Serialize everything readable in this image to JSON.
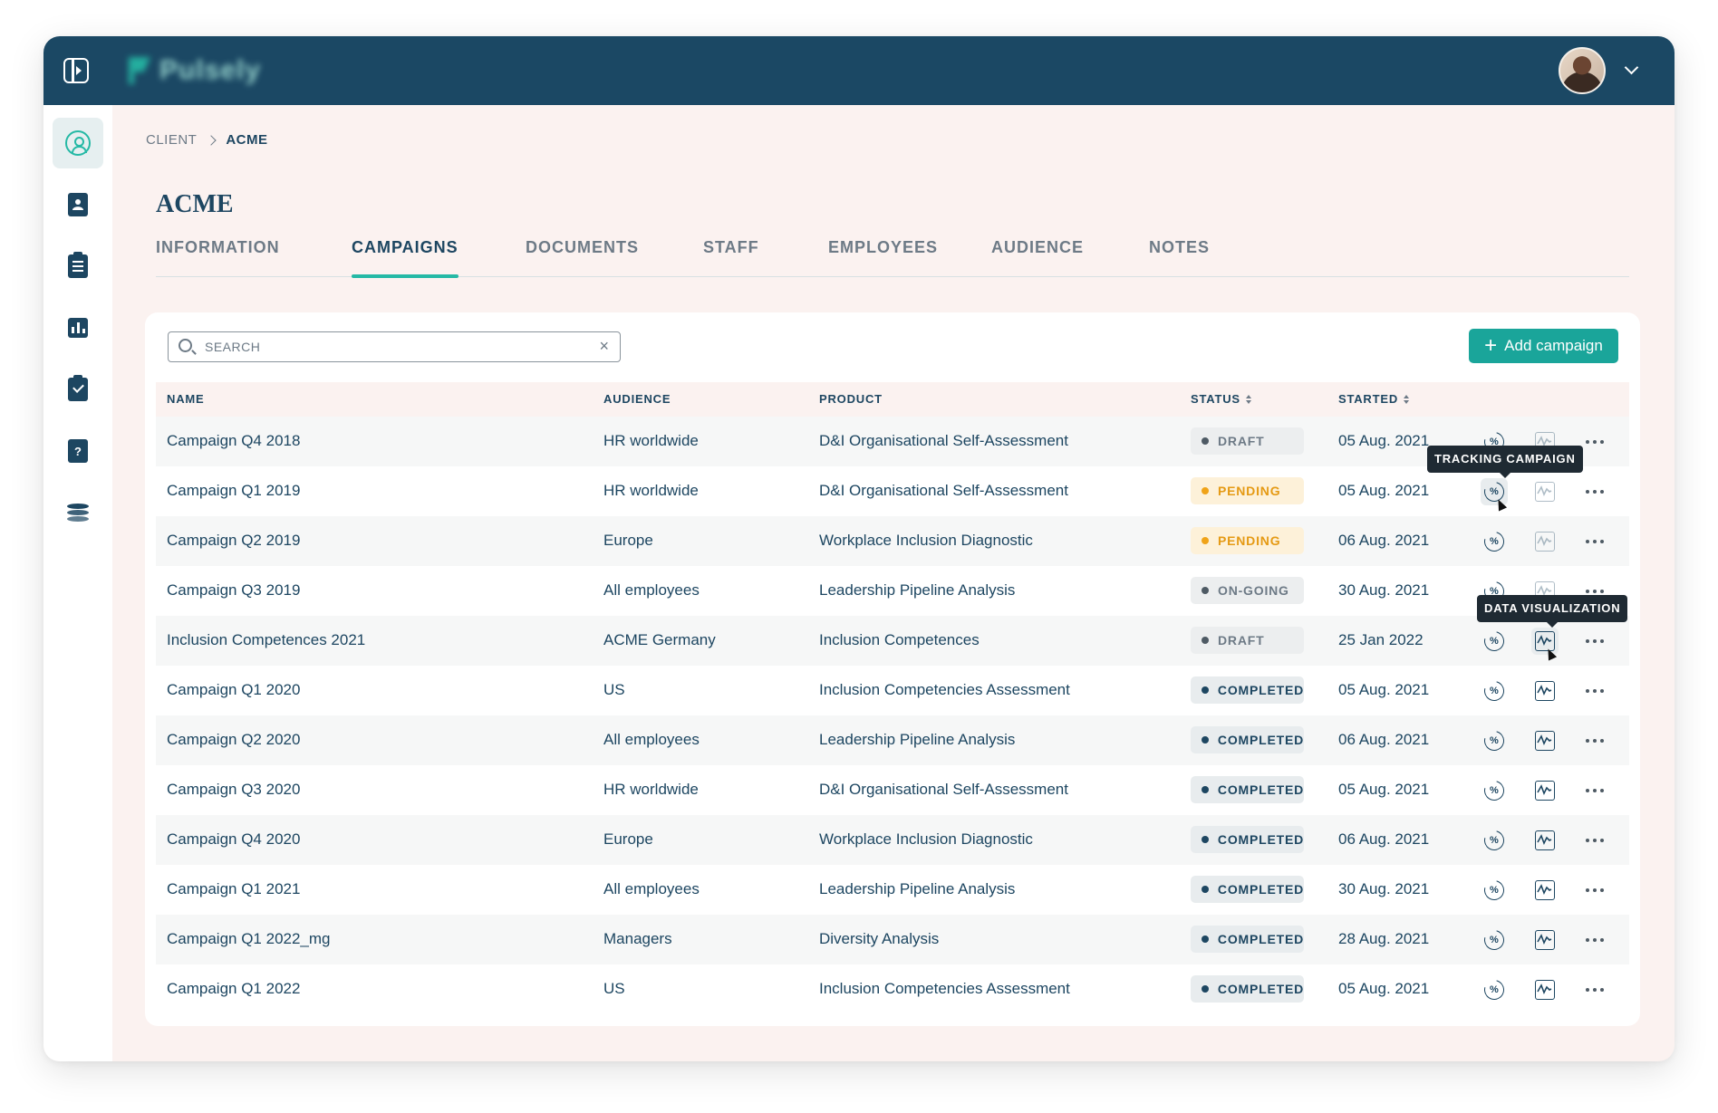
{
  "app": {
    "logo_text": "Pulsely",
    "user_avatar": "user-avatar"
  },
  "colors": {
    "topbar": "#1b4864",
    "accent": "#25b9a5",
    "button": "#1aa59a",
    "pending": "#f0a318",
    "background": "#fbf2f0"
  },
  "sidebar": {
    "items": [
      {
        "icon": "client-icon",
        "active": true
      },
      {
        "icon": "contact-card-icon",
        "active": false
      },
      {
        "icon": "clipboard-icon",
        "active": false
      },
      {
        "icon": "bar-chart-icon",
        "active": false
      },
      {
        "icon": "task-check-icon",
        "active": false
      },
      {
        "icon": "help-icon",
        "active": false
      },
      {
        "icon": "layers-icon",
        "active": false
      }
    ],
    "help_glyph": "?"
  },
  "breadcrumb": {
    "items": [
      "CLIENT",
      "ACME"
    ]
  },
  "page": {
    "title": "ACME"
  },
  "tabs": [
    {
      "label": "INFORMATION",
      "active": false
    },
    {
      "label": "CAMPAIGNS",
      "active": true
    },
    {
      "label": "DOCUMENTS",
      "active": false
    },
    {
      "label": "STAFF",
      "active": false
    },
    {
      "label": "EMPLOYEES",
      "active": false
    },
    {
      "label": "AUDIENCE",
      "active": false
    },
    {
      "label": "NOTES",
      "active": false
    }
  ],
  "toolbar": {
    "search_placeholder": "SEARCH",
    "search_value": "",
    "clear_glyph": "×",
    "add_label": "Add campaign",
    "add_glyph": "+"
  },
  "table": {
    "columns": [
      "NAME",
      "AUDIENCE",
      "PRODUCT",
      "STATUS",
      "STARTED"
    ],
    "rows": [
      {
        "name": "Campaign Q4 2018",
        "audience": "HR worldwide",
        "product": "D&I Organisational Self-Assessment",
        "status": "DRAFT",
        "started": "05 Aug. 2021"
      },
      {
        "name": "Campaign Q1 2019",
        "audience": "HR worldwide",
        "product": "D&I Organisational Self-Assessment",
        "status": "PENDING",
        "started": "05 Aug. 2021"
      },
      {
        "name": "Campaign Q2 2019",
        "audience": "Europe",
        "product": "Workplace Inclusion Diagnostic",
        "status": "PENDING",
        "started": "06 Aug. 2021"
      },
      {
        "name": "Campaign Q3 2019",
        "audience": "All employees",
        "product": "Leadership Pipeline Analysis",
        "status": "ON-GOING",
        "started": "30 Aug. 2021"
      },
      {
        "name": "Inclusion Competences 2021",
        "audience": "ACME Germany",
        "product": "Inclusion Competences",
        "status": "DRAFT",
        "started": "25 Jan 2022"
      },
      {
        "name": "Campaign Q1 2020",
        "audience": "US",
        "product": "Inclusion Competencies Assessment",
        "status": "COMPLETED",
        "started": "05 Aug. 2021"
      },
      {
        "name": "Campaign Q2 2020",
        "audience": "All employees",
        "product": "Leadership Pipeline Analysis",
        "status": "COMPLETED",
        "started": "06 Aug. 2021"
      },
      {
        "name": "Campaign Q3 2020",
        "audience": "HR worldwide",
        "product": "D&I Organisational Self-Assessment",
        "status": "COMPLETED",
        "started": "05 Aug. 2021"
      },
      {
        "name": "Campaign Q4 2020",
        "audience": "Europe",
        "product": "Workplace Inclusion Diagnostic",
        "status": "COMPLETED",
        "started": "06 Aug. 2021"
      },
      {
        "name": "Campaign Q1 2021",
        "audience": "All employees",
        "product": "Leadership Pipeline Analysis",
        "status": "COMPLETED",
        "started": "30 Aug. 2021"
      },
      {
        "name": "Campaign Q1 2022_mg",
        "audience": "Managers",
        "product": "Diversity Analysis",
        "status": "COMPLETED",
        "started": "28 Aug. 2021"
      },
      {
        "name": "Campaign Q1 2022",
        "audience": "US",
        "product": "Inclusion Competencies Assessment",
        "status": "COMPLETED",
        "started": "05 Aug. 2021"
      }
    ],
    "row_actions": [
      "tracking-icon",
      "data-visualization-icon",
      "more-options-icon"
    ],
    "tracking_glyph": "%"
  },
  "tooltips": {
    "tracking": "TRACKING CAMPAIGN",
    "visualization": "DATA VISUALIZATION"
  }
}
